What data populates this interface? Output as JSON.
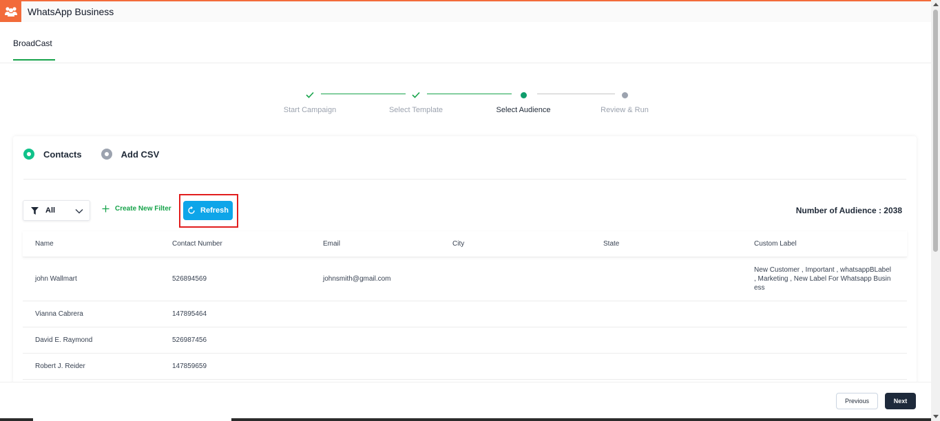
{
  "app": {
    "title": "WhatsApp Business",
    "logo_icon": "users-icon",
    "accent": "#f26b3a"
  },
  "tabs": [
    {
      "label": "BroadCast",
      "active": true
    }
  ],
  "stepper": {
    "steps": [
      {
        "label": "Start Campaign",
        "state": "done"
      },
      {
        "label": "Select Template",
        "state": "done"
      },
      {
        "label": "Select Audience",
        "state": "current"
      },
      {
        "label": "Review & Run",
        "state": "pending"
      }
    ],
    "color_done": "#16a34a",
    "color_pending": "#9ca3af"
  },
  "source": {
    "options": [
      {
        "label": "Contacts",
        "selected": true
      },
      {
        "label": "Add CSV",
        "selected": false
      }
    ]
  },
  "toolbar": {
    "filter_value": "All",
    "create_filter_label": "Create New Filter",
    "refresh_label": "Refresh",
    "audience_label": "Number of Audience : 2038"
  },
  "table": {
    "headers": [
      "Name",
      "Contact Number",
      "Email",
      "City",
      "State",
      "Custom Label"
    ],
    "rows": [
      [
        "john Wallmart",
        "526894569",
        "johnsmith@gmail.com",
        "",
        "",
        "New Customer , Important , whatsappBLabel , Marketing , New Label For Whatsapp Business"
      ],
      [
        "Vianna Cabrera",
        "147895464",
        "",
        "",
        "",
        ""
      ],
      [
        "David E. Raymond",
        "526987456",
        "",
        "",
        "",
        ""
      ],
      [
        "Robert J. Reider",
        "147859659",
        "",
        "",
        "",
        ""
      ]
    ]
  },
  "footer": {
    "previous_label": "Previous",
    "next_label": "Next"
  }
}
